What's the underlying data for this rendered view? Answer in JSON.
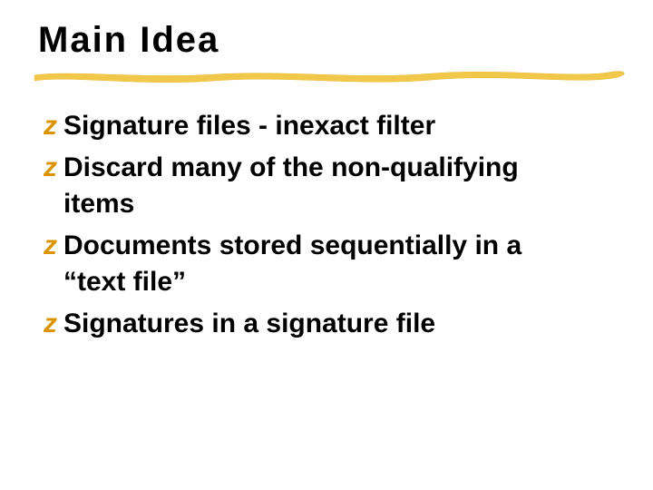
{
  "slide": {
    "title": "Main Idea",
    "bullet_marker": "z",
    "bullets": [
      {
        "text": "Signature files - inexact filter"
      },
      {
        "text": "Discard many of the non-qualifying items"
      },
      {
        "text": "Documents stored sequentially in a “text file”"
      },
      {
        "text": "Signatures in a signature file"
      }
    ],
    "colors": {
      "accent": "#d99400",
      "underline": "#f2c84b"
    }
  }
}
